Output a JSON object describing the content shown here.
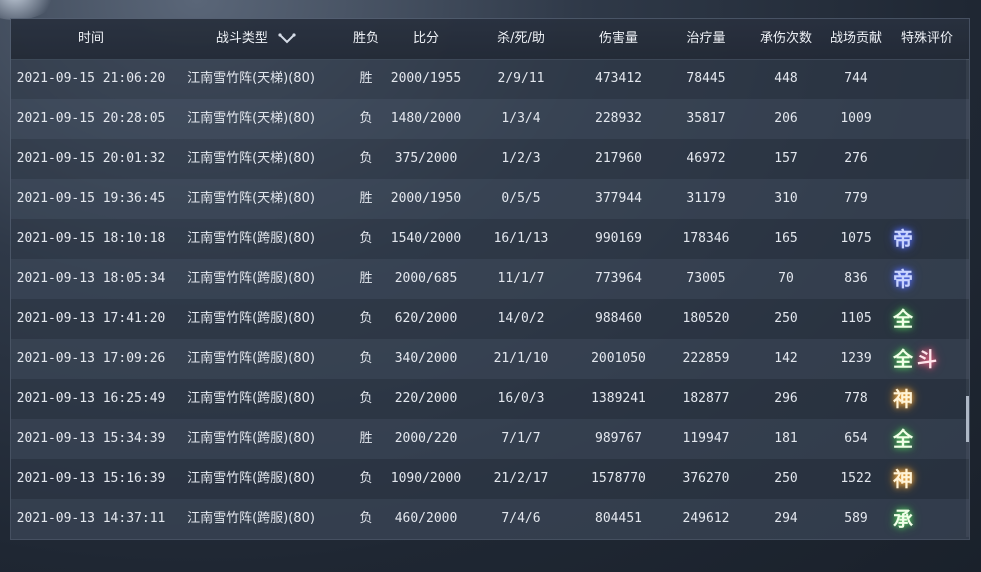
{
  "columns": {
    "time": "时间",
    "type": "战斗类型",
    "result": "胜负",
    "score": "比分",
    "kda": "杀/死/助",
    "damage": "伤害量",
    "heal": "治疗量",
    "taken": "承伤次数",
    "contrib": "战场贡献",
    "rating": "特殊评价"
  },
  "rows": [
    {
      "time": "2021-09-15 21:06:20",
      "type": "江南雪竹阵(天梯)(80)",
      "result": "胜",
      "score": "2000/1955",
      "kda": "2/9/11",
      "damage": "473412",
      "heal": "78445",
      "taken": "448",
      "contrib": "744",
      "badges": []
    },
    {
      "time": "2021-09-15 20:28:05",
      "type": "江南雪竹阵(天梯)(80)",
      "result": "负",
      "score": "1480/2000",
      "kda": "1/3/4",
      "damage": "228932",
      "heal": "35817",
      "taken": "206",
      "contrib": "1009",
      "badges": []
    },
    {
      "time": "2021-09-15 20:01:32",
      "type": "江南雪竹阵(天梯)(80)",
      "result": "负",
      "score": "375/2000",
      "kda": "1/2/3",
      "damage": "217960",
      "heal": "46972",
      "taken": "157",
      "contrib": "276",
      "badges": []
    },
    {
      "time": "2021-09-15 19:36:45",
      "type": "江南雪竹阵(天梯)(80)",
      "result": "胜",
      "score": "2000/1950",
      "kda": "0/5/5",
      "damage": "377944",
      "heal": "31179",
      "taken": "310",
      "contrib": "779",
      "badges": []
    },
    {
      "time": "2021-09-15 18:10:18",
      "type": "江南雪竹阵(跨服)(80)",
      "result": "负",
      "score": "1540/2000",
      "kda": "16/1/13",
      "damage": "990169",
      "heal": "178346",
      "taken": "165",
      "contrib": "1075",
      "badges": [
        {
          "char": "帝",
          "color": "blue"
        }
      ]
    },
    {
      "time": "2021-09-13 18:05:34",
      "type": "江南雪竹阵(跨服)(80)",
      "result": "胜",
      "score": "2000/685",
      "kda": "11/1/7",
      "damage": "773964",
      "heal": "73005",
      "taken": "70",
      "contrib": "836",
      "badges": [
        {
          "char": "帝",
          "color": "blue"
        }
      ]
    },
    {
      "time": "2021-09-13 17:41:20",
      "type": "江南雪竹阵(跨服)(80)",
      "result": "负",
      "score": "620/2000",
      "kda": "14/0/2",
      "damage": "988460",
      "heal": "180520",
      "taken": "250",
      "contrib": "1105",
      "badges": [
        {
          "char": "全",
          "color": "green"
        }
      ]
    },
    {
      "time": "2021-09-13 17:09:26",
      "type": "江南雪竹阵(跨服)(80)",
      "result": "负",
      "score": "340/2000",
      "kda": "21/1/10",
      "damage": "2001050",
      "heal": "222859",
      "taken": "142",
      "contrib": "1239",
      "badges": [
        {
          "char": "全",
          "color": "green"
        },
        {
          "char": "斗",
          "color": "red"
        }
      ]
    },
    {
      "time": "2021-09-13 16:25:49",
      "type": "江南雪竹阵(跨服)(80)",
      "result": "负",
      "score": "220/2000",
      "kda": "16/0/3",
      "damage": "1389241",
      "heal": "182877",
      "taken": "296",
      "contrib": "778",
      "badges": [
        {
          "char": "神",
          "color": "gold"
        }
      ]
    },
    {
      "time": "2021-09-13 15:34:39",
      "type": "江南雪竹阵(跨服)(80)",
      "result": "胜",
      "score": "2000/220",
      "kda": "7/1/7",
      "damage": "989767",
      "heal": "119947",
      "taken": "181",
      "contrib": "654",
      "badges": [
        {
          "char": "全",
          "color": "green"
        }
      ]
    },
    {
      "time": "2021-09-13 15:16:39",
      "type": "江南雪竹阵(跨服)(80)",
      "result": "负",
      "score": "1090/2000",
      "kda": "21/2/17",
      "damage": "1578770",
      "heal": "376270",
      "taken": "250",
      "contrib": "1522",
      "badges": [
        {
          "char": "神",
          "color": "gold"
        }
      ]
    },
    {
      "time": "2021-09-13 14:37:11",
      "type": "江南雪竹阵(跨服)(80)",
      "result": "负",
      "score": "460/2000",
      "kda": "7/4/6",
      "damage": "804451",
      "heal": "249612",
      "taken": "294",
      "contrib": "589",
      "badges": [
        {
          "char": "承",
          "color": "green"
        }
      ]
    }
  ],
  "scroll_position": 0.78
}
